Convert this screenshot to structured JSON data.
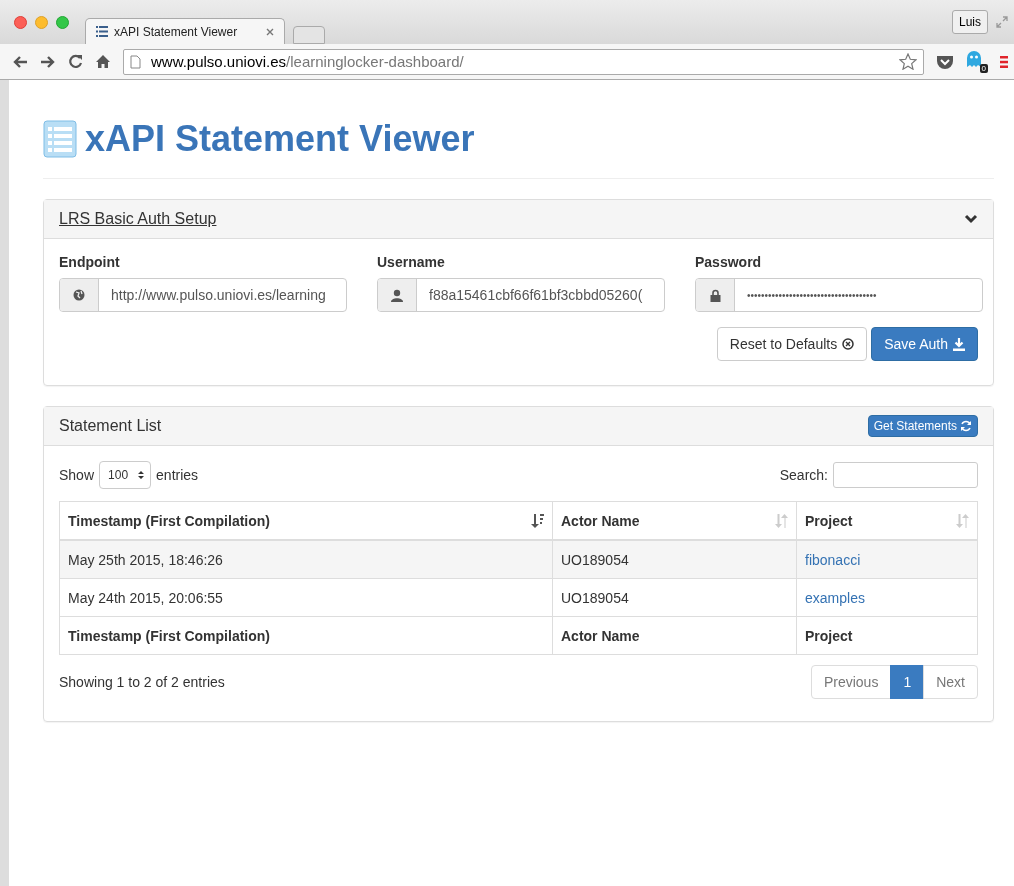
{
  "browser": {
    "tabs": [
      {
        "title": "xAPI Statement Viewer",
        "selected": true
      }
    ],
    "profile": "Luis",
    "url_host": "www.pulso.uniovi.es",
    "url_path": "/learninglocker-dashboard/",
    "extension_badge": "0"
  },
  "page_title": "xAPI Statement Viewer",
  "auth_panel": {
    "title": "LRS Basic Auth Setup",
    "expanded": true,
    "fields": [
      {
        "label": "Endpoint",
        "kind": "globe",
        "value": "http://www.pulso.uniovi.es/learning"
      },
      {
        "label": "Username",
        "kind": "user",
        "value": "f88a15461cbf66f61bf3cbbd05260("
      },
      {
        "label": "Password",
        "kind": "lock",
        "value": "•••••••••••••••••••••••••••••••••••••"
      }
    ],
    "buttons": [
      {
        "label": "Reset to Defaults",
        "kind": "reset"
      },
      {
        "label": "Save Auth",
        "kind": "save"
      }
    ]
  },
  "list_panel": {
    "title": "Statement List",
    "action": "Get Statements",
    "show_label": "Show",
    "page_size": "100",
    "entries_label": "entries",
    "search_label": "Search:",
    "columns": [
      {
        "label": "Timestamp (First Compilation)",
        "sorted": true
      },
      {
        "label": "Actor Name",
        "sorted": false
      },
      {
        "label": "Project",
        "sorted": false
      }
    ],
    "rows": [
      {
        "timestamp": "May 25th 2015, 18:46:26",
        "actor": "UO189054",
        "project": "fibonacci"
      },
      {
        "timestamp": "May 24th 2015, 20:06:55",
        "actor": "UO189054",
        "project": "examples"
      }
    ],
    "footer_columns": [
      "Timestamp (First Compilation)",
      "Actor Name",
      "Project"
    ],
    "info": "Showing 1 to 2 of 2 entries",
    "pagination": [
      {
        "label": "Previous",
        "selected": false
      },
      {
        "label": "1",
        "selected": true
      },
      {
        "label": "Next",
        "selected": false
      }
    ]
  }
}
